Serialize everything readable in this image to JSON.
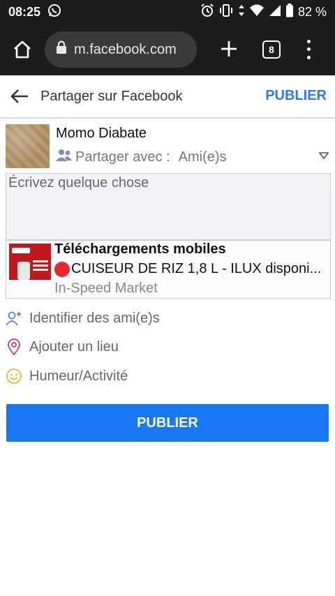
{
  "status_bar": {
    "time": "08:25",
    "battery": "82 %",
    "icons": [
      "whatsapp-icon",
      "alarm-icon",
      "vibrate-icon",
      "data-arrows-icon",
      "wifi-icon",
      "signal-icon",
      "battery-icon"
    ]
  },
  "browser": {
    "url": "m.facebook.com",
    "tab_count": "8"
  },
  "header": {
    "title": "Partager sur Facebook",
    "publish_label": "PUBLIER"
  },
  "user": {
    "name": "Momo Diabate",
    "share_label": "Partager avec :",
    "share_value": "Ami(e)s"
  },
  "composer": {
    "placeholder": "Écrivez quelque chose"
  },
  "link_card": {
    "title": "Téléchargements mobiles",
    "description": "CUISEUR DE RIZ 1,8 L - ILUX disponi...",
    "source": "In-Speed Market"
  },
  "options": [
    {
      "label": "Identifier des ami(e)s",
      "icon": "tag-friend-icon"
    },
    {
      "label": "Ajouter un lieu",
      "icon": "location-pin-icon"
    },
    {
      "label": "Humeur/Activité",
      "icon": "smiley-icon"
    }
  ],
  "main_button": {
    "label": "PUBLIER"
  },
  "colors": {
    "accent": "#1877f2",
    "header_link": "#2a7be4",
    "browser_bar": "#1c1c1c"
  }
}
